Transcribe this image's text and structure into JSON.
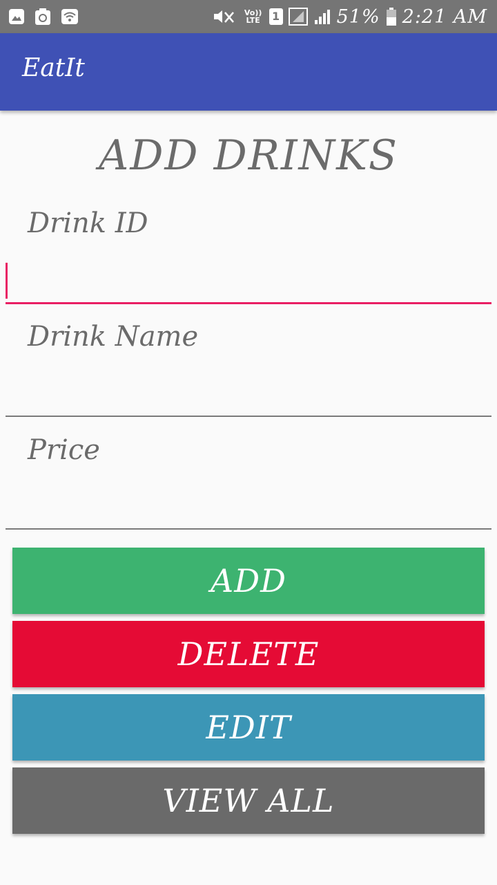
{
  "status_bar": {
    "battery": "51%",
    "time": "2:21 AM",
    "network_label": "Vo)) LTE",
    "sim_number": "1",
    "icons": [
      "gallery-icon",
      "recycle-icon",
      "wifi-icon",
      "mute-icon",
      "signal-icon",
      "battery-icon"
    ]
  },
  "app_bar": {
    "title": "EatIt",
    "color": "#3f51b5"
  },
  "page": {
    "title": "ADD DRINKS"
  },
  "fields": {
    "drink_id": {
      "label": "Drink ID",
      "value": "",
      "focused": true
    },
    "drink_name": {
      "label": "Drink Name",
      "value": ""
    },
    "price": {
      "label": "Price",
      "value": ""
    }
  },
  "colors": {
    "accent": "#e91e63",
    "add": "#3db370",
    "delete": "#e50b35",
    "edit": "#3c96b6",
    "view_all": "#6a6a6a"
  },
  "buttons": {
    "add": "ADD",
    "delete": "DELETE",
    "edit": "EDIT",
    "view_all": "VIEW ALL"
  }
}
